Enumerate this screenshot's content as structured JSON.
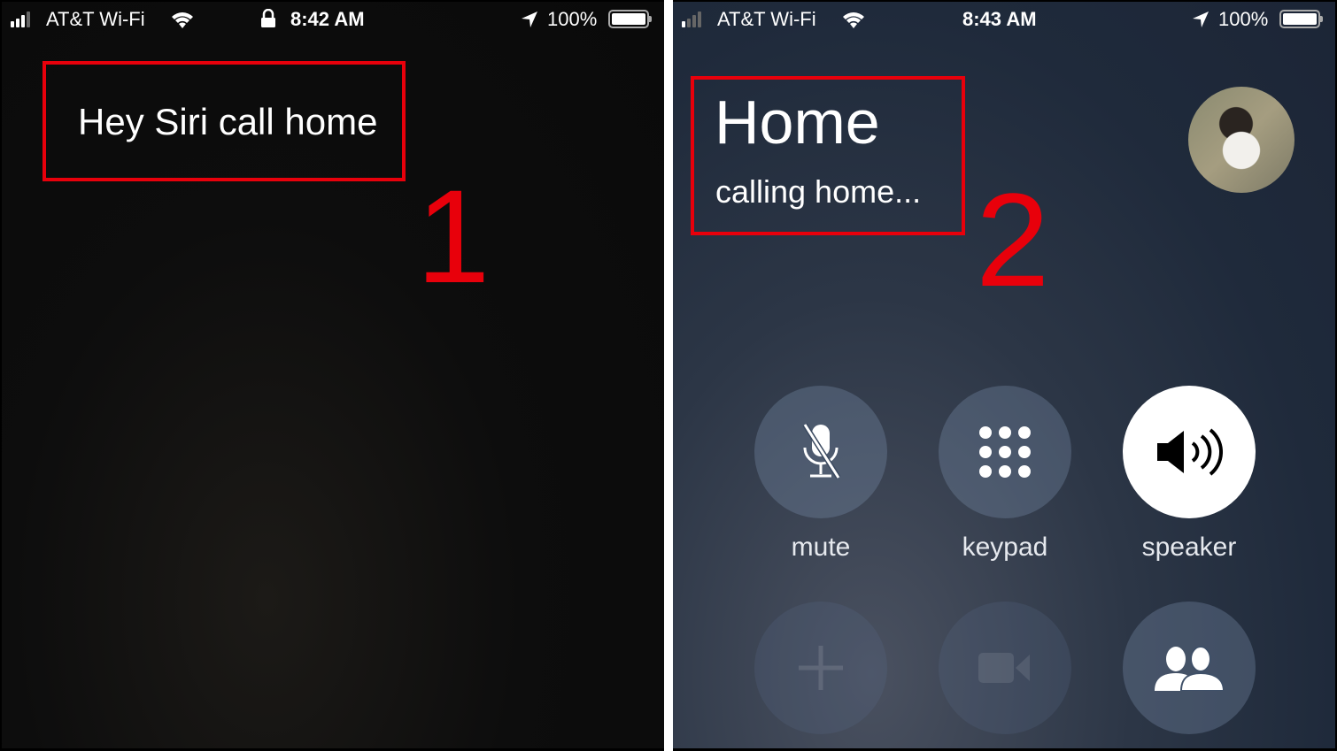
{
  "left": {
    "status": {
      "carrier": "AT&T Wi-Fi",
      "time": "8:42 AM",
      "battery": "100%",
      "signal_icon": "signal-bars-icon",
      "wifi_icon": "wifi-icon",
      "lock_icon": "lock-icon",
      "location_icon": "location-arrow-icon"
    },
    "siri_text": "Hey Siri call home",
    "step_number": "1"
  },
  "right": {
    "status": {
      "carrier": "AT&T Wi-Fi",
      "time": "8:43 AM",
      "battery": "100%"
    },
    "contact_name": "Home",
    "call_status": "calling home...",
    "step_number": "2",
    "buttons": [
      {
        "label": "mute",
        "icon": "mute-microphone-icon",
        "enabled": true
      },
      {
        "label": "keypad",
        "icon": "keypad-icon",
        "enabled": true
      },
      {
        "label": "speaker",
        "icon": "speaker-icon",
        "enabled": true,
        "active": true
      },
      {
        "label": "",
        "icon": "add-call-icon",
        "enabled": false
      },
      {
        "label": "",
        "icon": "facetime-video-icon",
        "enabled": false
      },
      {
        "label": "",
        "icon": "contacts-icon",
        "enabled": true
      }
    ]
  },
  "colors": {
    "annotation_red": "#e8000b"
  }
}
